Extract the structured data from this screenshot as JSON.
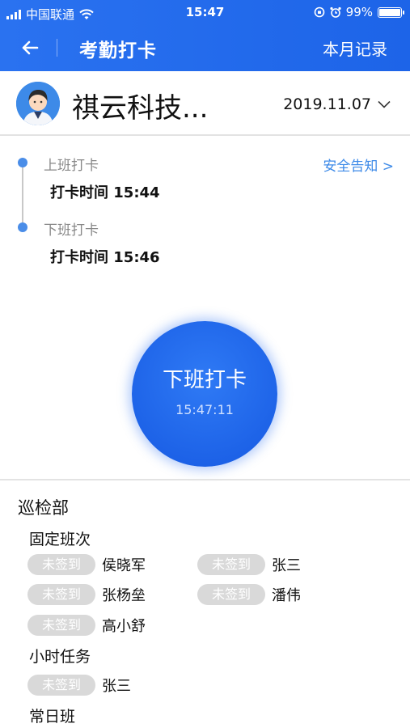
{
  "status_bar": {
    "carrier": "中国联通",
    "time": "15:47",
    "battery": "99%",
    "battery_level": 0.99
  },
  "nav": {
    "title": "考勤打卡",
    "right_link": "本月记录"
  },
  "company": {
    "name": "祺云科技...",
    "date": "2019.11.07"
  },
  "timeline": {
    "safety_link": "安全告知 >",
    "entries": [
      {
        "label": "上班打卡",
        "time": "打卡时间 15:44"
      },
      {
        "label": "下班打卡",
        "time": "打卡时间 15:46"
      }
    ]
  },
  "punch": {
    "label": "下班打卡",
    "time": "15:47:11"
  },
  "department": {
    "name": "巡检部",
    "groups": [
      {
        "name": "固定班次",
        "members": [
          {
            "status": "未签到",
            "name": "侯晓军"
          },
          {
            "status": "未签到",
            "name": "张三"
          },
          {
            "status": "未签到",
            "name": "张杨垒"
          },
          {
            "status": "未签到",
            "name": "潘伟"
          },
          {
            "status": "未签到",
            "name": "高小舒"
          }
        ]
      },
      {
        "name": "小时任务",
        "members": [
          {
            "status": "未签到",
            "name": "张三"
          }
        ]
      },
      {
        "name": "常日班",
        "members": []
      }
    ]
  },
  "colors": {
    "primary": "#1d64e8",
    "link": "#3d8ae8",
    "badge": "#d9d9d9"
  }
}
